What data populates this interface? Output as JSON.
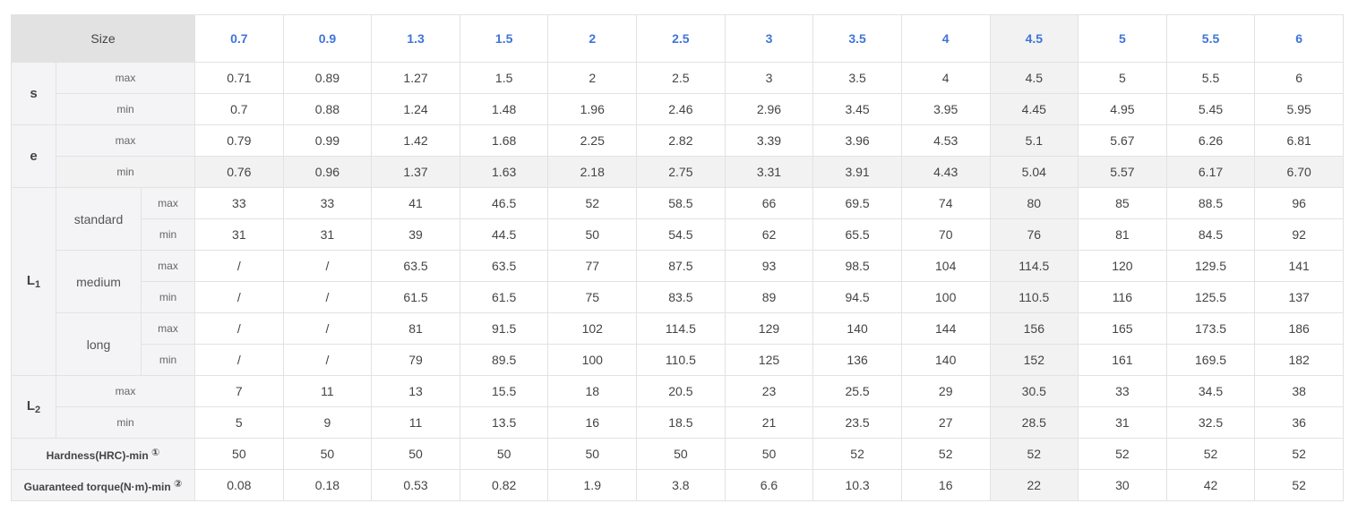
{
  "size_label": "Size",
  "sizes": [
    "0.7",
    "0.9",
    "1.3",
    "1.5",
    "2",
    "2.5",
    "3",
    "3.5",
    "4",
    "4.5",
    "5",
    "5.5",
    "6"
  ],
  "highlight_col": 9,
  "max_label": "max",
  "min_label": "min",
  "s": {
    "label": "s",
    "max": [
      "0.71",
      "0.89",
      "1.27",
      "1.5",
      "2",
      "2.5",
      "3",
      "3.5",
      "4",
      "4.5",
      "5",
      "5.5",
      "6"
    ],
    "min": [
      "0.7",
      "0.88",
      "1.24",
      "1.48",
      "1.96",
      "2.46",
      "2.96",
      "3.45",
      "3.95",
      "4.45",
      "4.95",
      "5.45",
      "5.95"
    ]
  },
  "e": {
    "label": "e",
    "max": [
      "0.79",
      "0.99",
      "1.42",
      "1.68",
      "2.25",
      "2.82",
      "3.39",
      "3.96",
      "4.53",
      "5.1",
      "5.67",
      "6.26",
      "6.81"
    ],
    "min": [
      "0.76",
      "0.96",
      "1.37",
      "1.63",
      "2.18",
      "2.75",
      "3.31",
      "3.91",
      "4.43",
      "5.04",
      "5.57",
      "6.17",
      "6.70"
    ]
  },
  "L1": {
    "label_main": "L",
    "label_sub": "1",
    "groups": [
      {
        "label": "standard",
        "max": [
          "33",
          "33",
          "41",
          "46.5",
          "52",
          "58.5",
          "66",
          "69.5",
          "74",
          "80",
          "85",
          "88.5",
          "96"
        ],
        "min": [
          "31",
          "31",
          "39",
          "44.5",
          "50",
          "54.5",
          "62",
          "65.5",
          "70",
          "76",
          "81",
          "84.5",
          "92"
        ]
      },
      {
        "label": "medium",
        "max": [
          "/",
          "/",
          "63.5",
          "63.5",
          "77",
          "87.5",
          "93",
          "98.5",
          "104",
          "114.5",
          "120",
          "129.5",
          "141"
        ],
        "min": [
          "/",
          "/",
          "61.5",
          "61.5",
          "75",
          "83.5",
          "89",
          "94.5",
          "100",
          "110.5",
          "116",
          "125.5",
          "137"
        ]
      },
      {
        "label": "long",
        "max": [
          "/",
          "/",
          "81",
          "91.5",
          "102",
          "114.5",
          "129",
          "140",
          "144",
          "156",
          "165",
          "173.5",
          "186"
        ],
        "min": [
          "/",
          "/",
          "79",
          "89.5",
          "100",
          "110.5",
          "125",
          "136",
          "140",
          "152",
          "161",
          "169.5",
          "182"
        ]
      }
    ]
  },
  "L2": {
    "label_main": "L",
    "label_sub": "2",
    "max": [
      "7",
      "11",
      "13",
      "15.5",
      "18",
      "20.5",
      "23",
      "25.5",
      "29",
      "30.5",
      "33",
      "34.5",
      "38"
    ],
    "min": [
      "5",
      "9",
      "11",
      "13.5",
      "16",
      "18.5",
      "21",
      "23.5",
      "27",
      "28.5",
      "31",
      "32.5",
      "36"
    ]
  },
  "hardness": {
    "label": "Hardness(HRC)-min",
    "note": "①",
    "values": [
      "50",
      "50",
      "50",
      "50",
      "50",
      "50",
      "50",
      "52",
      "52",
      "52",
      "52",
      "52",
      "52"
    ]
  },
  "torque": {
    "label": "Guaranteed torque(N·m)-min",
    "note": "②",
    "values": [
      "0.08",
      "0.18",
      "0.53",
      "0.82",
      "1.9",
      "3.8",
      "6.6",
      "10.3",
      "16",
      "22",
      "30",
      "42",
      "52"
    ]
  }
}
